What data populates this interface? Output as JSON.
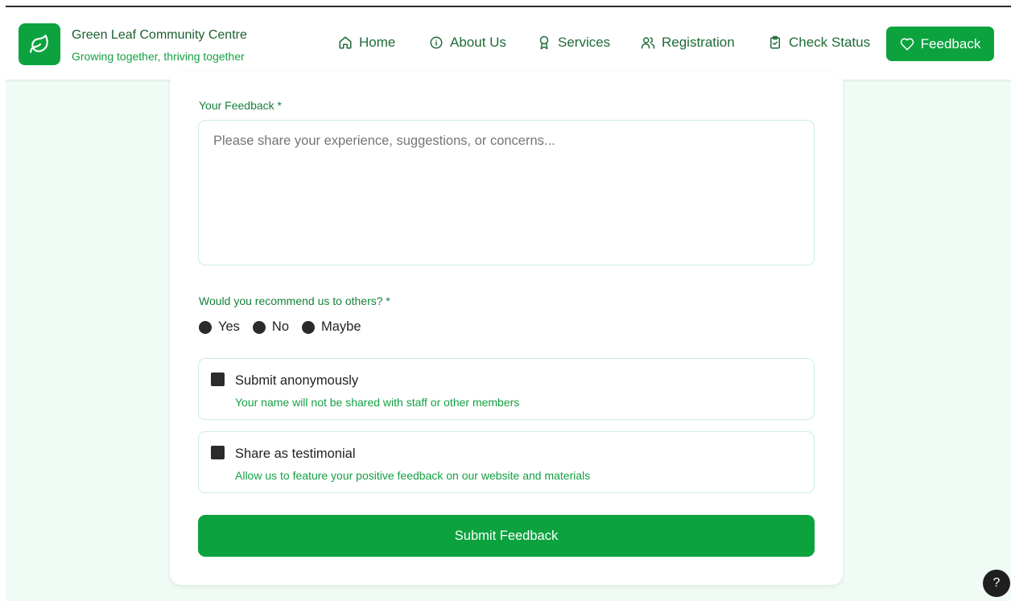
{
  "brand": {
    "name": "Green Leaf Community Centre",
    "tagline": "Growing together, thriving together",
    "logo_icon": "leaf-icon"
  },
  "nav": {
    "items": [
      {
        "label": "Home",
        "icon": "home-icon"
      },
      {
        "label": "About Us",
        "icon": "info-icon"
      },
      {
        "label": "Services",
        "icon": "award-icon"
      },
      {
        "label": "Registration",
        "icon": "users-icon"
      },
      {
        "label": "Check Status",
        "icon": "clipboard-check-icon"
      }
    ],
    "active": {
      "label": "Feedback",
      "icon": "heart-icon"
    }
  },
  "form": {
    "feedback_label": "Your Feedback *",
    "feedback_placeholder": "Please share your experience, suggestions, or concerns...",
    "recommend_label": "Would you recommend us to others? *",
    "recommend_options": [
      "Yes",
      "No",
      "Maybe"
    ],
    "anonymous": {
      "title": "Submit anonymously",
      "description": "Your name will not be shared with staff or other members"
    },
    "testimonial": {
      "title": "Share as testimonial",
      "description": "Allow us to feature your positive feedback on our website and materials"
    },
    "submit_label": "Submit Feedback"
  },
  "help": {
    "label": "?"
  },
  "colors": {
    "accent": "#0ca33f",
    "background": "#effbf4",
    "label_green": "#16803a"
  }
}
